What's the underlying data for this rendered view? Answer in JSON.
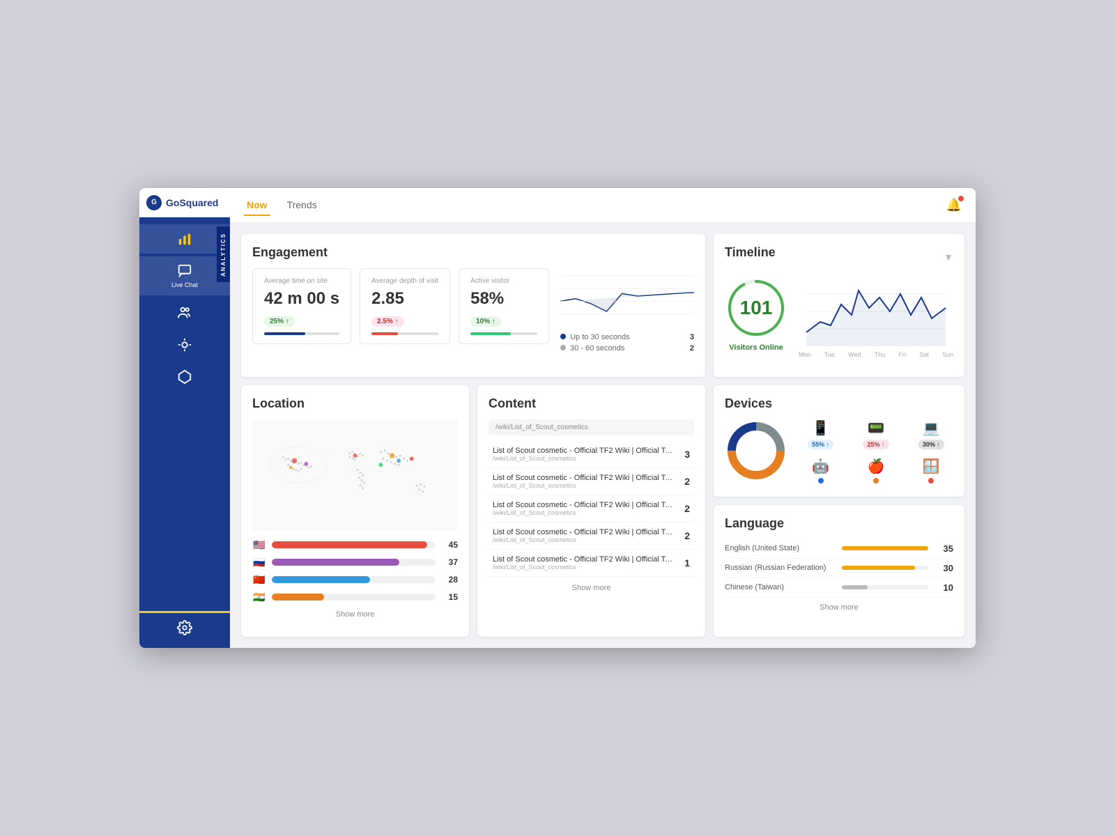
{
  "app": {
    "name": "GoSquared",
    "logo_text": "GoSquared"
  },
  "nav": {
    "tabs": [
      {
        "id": "now",
        "label": "Now",
        "active": true
      },
      {
        "id": "trends",
        "label": "Trends",
        "active": false
      }
    ]
  },
  "sidebar": {
    "analytics_label": "ANALYTICS",
    "items": [
      {
        "id": "analytics",
        "icon": "📊",
        "label": "",
        "active": true,
        "yellow": true
      },
      {
        "id": "chat",
        "icon": "💬",
        "label": "Live Chat",
        "active": true
      },
      {
        "id": "people",
        "icon": "👥",
        "label": ""
      },
      {
        "id": "assist",
        "icon": "🔧",
        "label": ""
      },
      {
        "id": "apps",
        "icon": "⬡",
        "label": ""
      }
    ],
    "settings_label": ""
  },
  "engagement": {
    "title": "Engagement",
    "metrics": [
      {
        "label": "Average time on site",
        "value": "42 m 00 s",
        "badge": "25% ↑",
        "badge_type": "green",
        "bar_color": "#1a3a8c",
        "bar_pct": 55
      },
      {
        "label": "Average depth of visit",
        "value": "2.85",
        "badge": "2.5% ↑",
        "badge_type": "red",
        "bar_color": "#e74c3c",
        "bar_pct": 40
      },
      {
        "label": "Active visitor",
        "value": "58%",
        "badge": "10% ↑",
        "badge_type": "green",
        "bar_color": "#2ecc71",
        "bar_pct": 60
      }
    ],
    "legend": [
      {
        "label": "Up to 30 seconds",
        "count": 3,
        "color": "#1a3a8c"
      },
      {
        "label": "30 - 60 seconds",
        "count": 2,
        "color": "#aaa"
      }
    ]
  },
  "timeline": {
    "title": "Timeline",
    "visitors_online": 101,
    "visitors_label": "Visitors Online",
    "days": [
      "Mon",
      "Tue",
      "Wed",
      "Thu",
      "Fri",
      "Sat",
      "Sun"
    ]
  },
  "location": {
    "title": "Location",
    "bars": [
      {
        "flag": "🇺🇸",
        "count": 45,
        "pct": 95,
        "color": "#e74c3c"
      },
      {
        "flag": "🇷🇺",
        "count": 37,
        "pct": 78,
        "color": "#9b59b6"
      },
      {
        "flag": "🇨🇳",
        "count": 28,
        "pct": 60,
        "color": "#e74c3c"
      },
      {
        "flag": "🇮🇳",
        "count": 15,
        "pct": 32,
        "color": "#e67e22"
      }
    ],
    "show_more": "Show more"
  },
  "content": {
    "title": "Content",
    "url_header": "/wiki/List_of_Scout_cosmetics",
    "rows": [
      {
        "title": "List of Scout cosmetic - Official TF2 Wiki | Official Te...",
        "url": "/wiki/List_of_Scout_cosmetics",
        "count": 3
      },
      {
        "title": "List of Scout cosmetic - Official TF2 Wiki | Official Te...",
        "url": "/wiki/List_of_Scout_cosmetics",
        "count": 2
      },
      {
        "title": "List of Scout cosmetic - Official TF2 Wiki | Official Te...",
        "url": "/wiki/List_of_Scout_cosmetics",
        "count": 2
      },
      {
        "title": "List of Scout cosmetic - Official TF2 Wiki | Official Te...",
        "url": "/wiki/List_of_Scout_cosmetics",
        "count": 2
      },
      {
        "title": "List of Scout cosmetic - Official TF2 Wiki | Official Te...",
        "url": "/wiki/List_of_Scout_cosmetics",
        "count": 1
      }
    ],
    "show_more": "Show more"
  },
  "devices": {
    "title": "Devices",
    "types": [
      {
        "icon": "📱",
        "badge": "55% ↑",
        "badge_type": "blue"
      },
      {
        "icon": "📱",
        "badge": "25% ↑",
        "badge_type": "pink"
      },
      {
        "icon": "💻",
        "badge": "30% ↑",
        "badge_type": "dark"
      }
    ],
    "os": [
      {
        "icon": "🤖",
        "dot_color": "#1a73e8"
      },
      {
        "icon": "🍎",
        "dot_color": "#e67e22"
      },
      {
        "icon": "🪟",
        "dot_color": "#e74c3c"
      }
    ],
    "donut": {
      "segments": [
        {
          "color": "#e67e22",
          "pct": 55
        },
        {
          "color": "#1a3a8c",
          "pct": 25
        },
        {
          "color": "#9b59b6",
          "pct": 20
        }
      ]
    }
  },
  "language": {
    "title": "Language",
    "rows": [
      {
        "name": "English (United State)",
        "count": 35,
        "pct": 100,
        "bar_type": "orange"
      },
      {
        "name": "Russian (Russian Federation)",
        "count": 30,
        "pct": 85,
        "bar_type": "orange"
      },
      {
        "name": "Chinese (Taiwan)",
        "count": 10,
        "pct": 30,
        "bar_type": "gray"
      }
    ],
    "show_more": "Show more"
  }
}
